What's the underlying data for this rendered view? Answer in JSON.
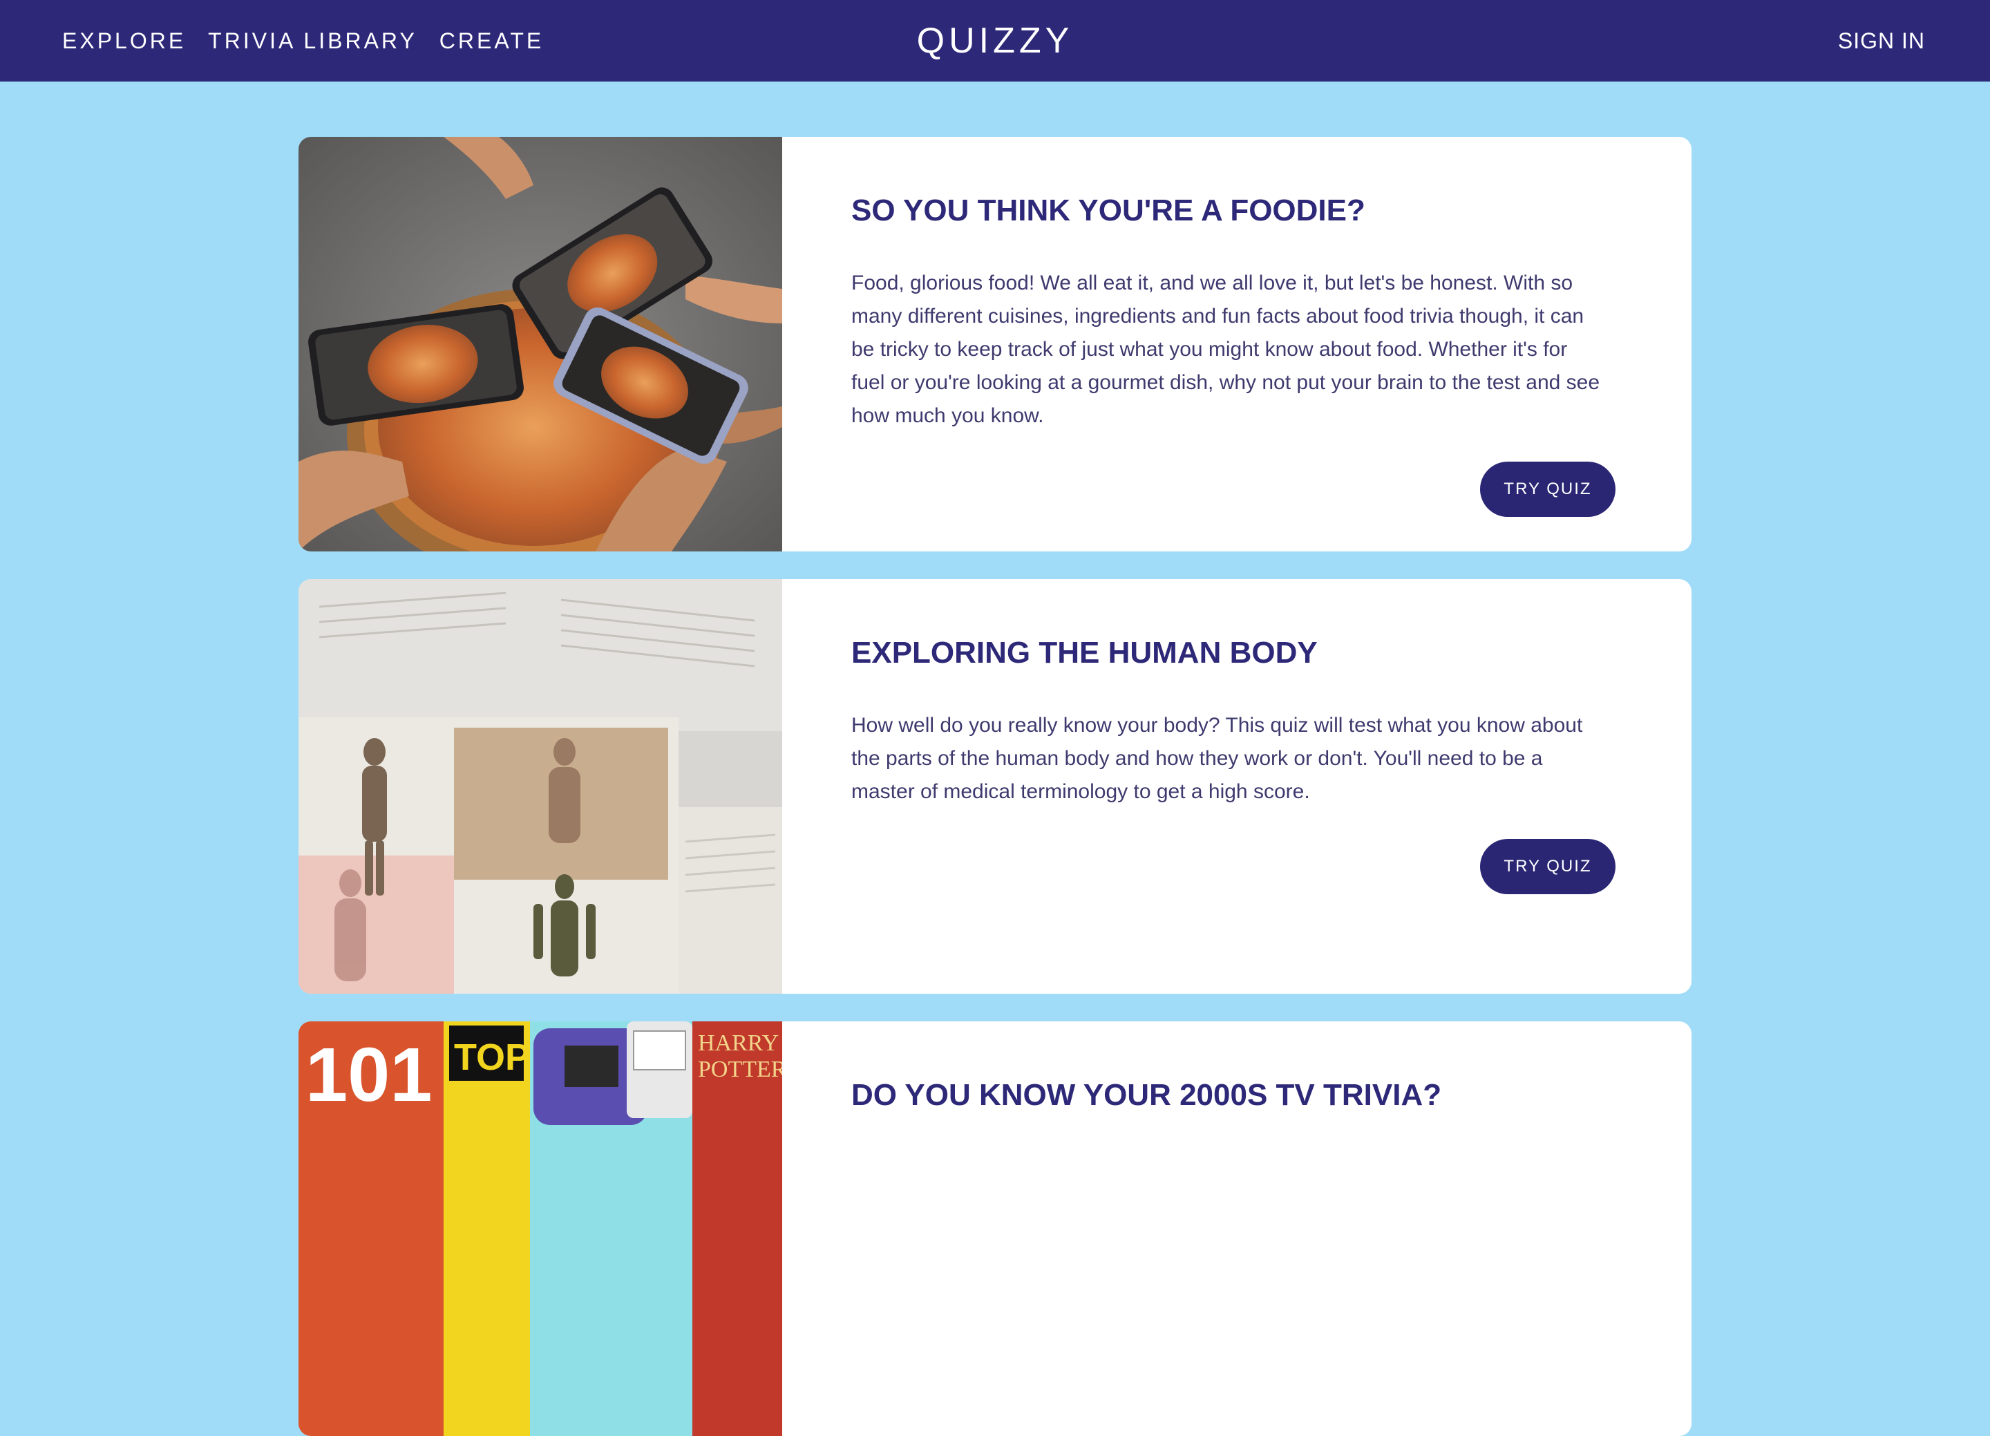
{
  "nav": {
    "links": [
      "Explore",
      "Trivia Library",
      "Create"
    ],
    "brand": "QUIZZY",
    "sign_in": "SIGN IN"
  },
  "colors": {
    "navbar": "#2d2878",
    "background": "#a0dcf7",
    "card": "#ffffff",
    "button": "#2a2674",
    "title": "#2d2878"
  },
  "quizzes": [
    {
      "title": "SO YOU THINK YOU'RE A FOODIE?",
      "description": "Food, glorious food! We all eat it, and we all love it, but let's be honest. With so many different cuisines, ingredients and fun facts about food trivia though, it can be tricky to keep track of just what you might know about food. Whether it's for fuel or you're looking at a gourmet dish, why not put your brain to the test and see how much you know.",
      "button": "TRY QUIZ",
      "image": "pizza-phones-photo"
    },
    {
      "title": "EXPLORING THE HUMAN BODY",
      "description": "How well do you really know your body? This quiz will test what you know about the parts of the human body and how they work or don't. You'll need to be a master of medical terminology to get a high score.",
      "button": "TRY QUIZ",
      "image": "anatomy-book-photo"
    },
    {
      "title": "DO YOU KNOW YOUR 2000S TV TRIVIA?",
      "image": "2000s-pop-culture-collage",
      "image_text": [
        "101",
        "TOP",
        "HARRY",
        "POTTER"
      ]
    }
  ]
}
